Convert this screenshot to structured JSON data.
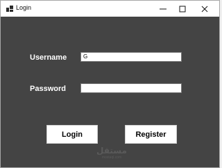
{
  "window": {
    "title": "Login",
    "controls": {
      "minimize": "minimize",
      "maximize": "maximize",
      "close": "close"
    }
  },
  "form": {
    "username_label": "Username",
    "username_value": "G",
    "password_label": "Password",
    "password_value": "",
    "login_label": "Login",
    "register_label": "Register"
  },
  "watermark": {
    "logo_text": "مستقل",
    "site": "mostaql.com"
  },
  "colors": {
    "background": "#444444",
    "titlebar": "#ffffff",
    "label": "#ffffff"
  },
  "icons": {
    "app": "app-window-icon",
    "minimize": "minimize-icon",
    "maximize": "maximize-icon",
    "close": "close-icon"
  }
}
